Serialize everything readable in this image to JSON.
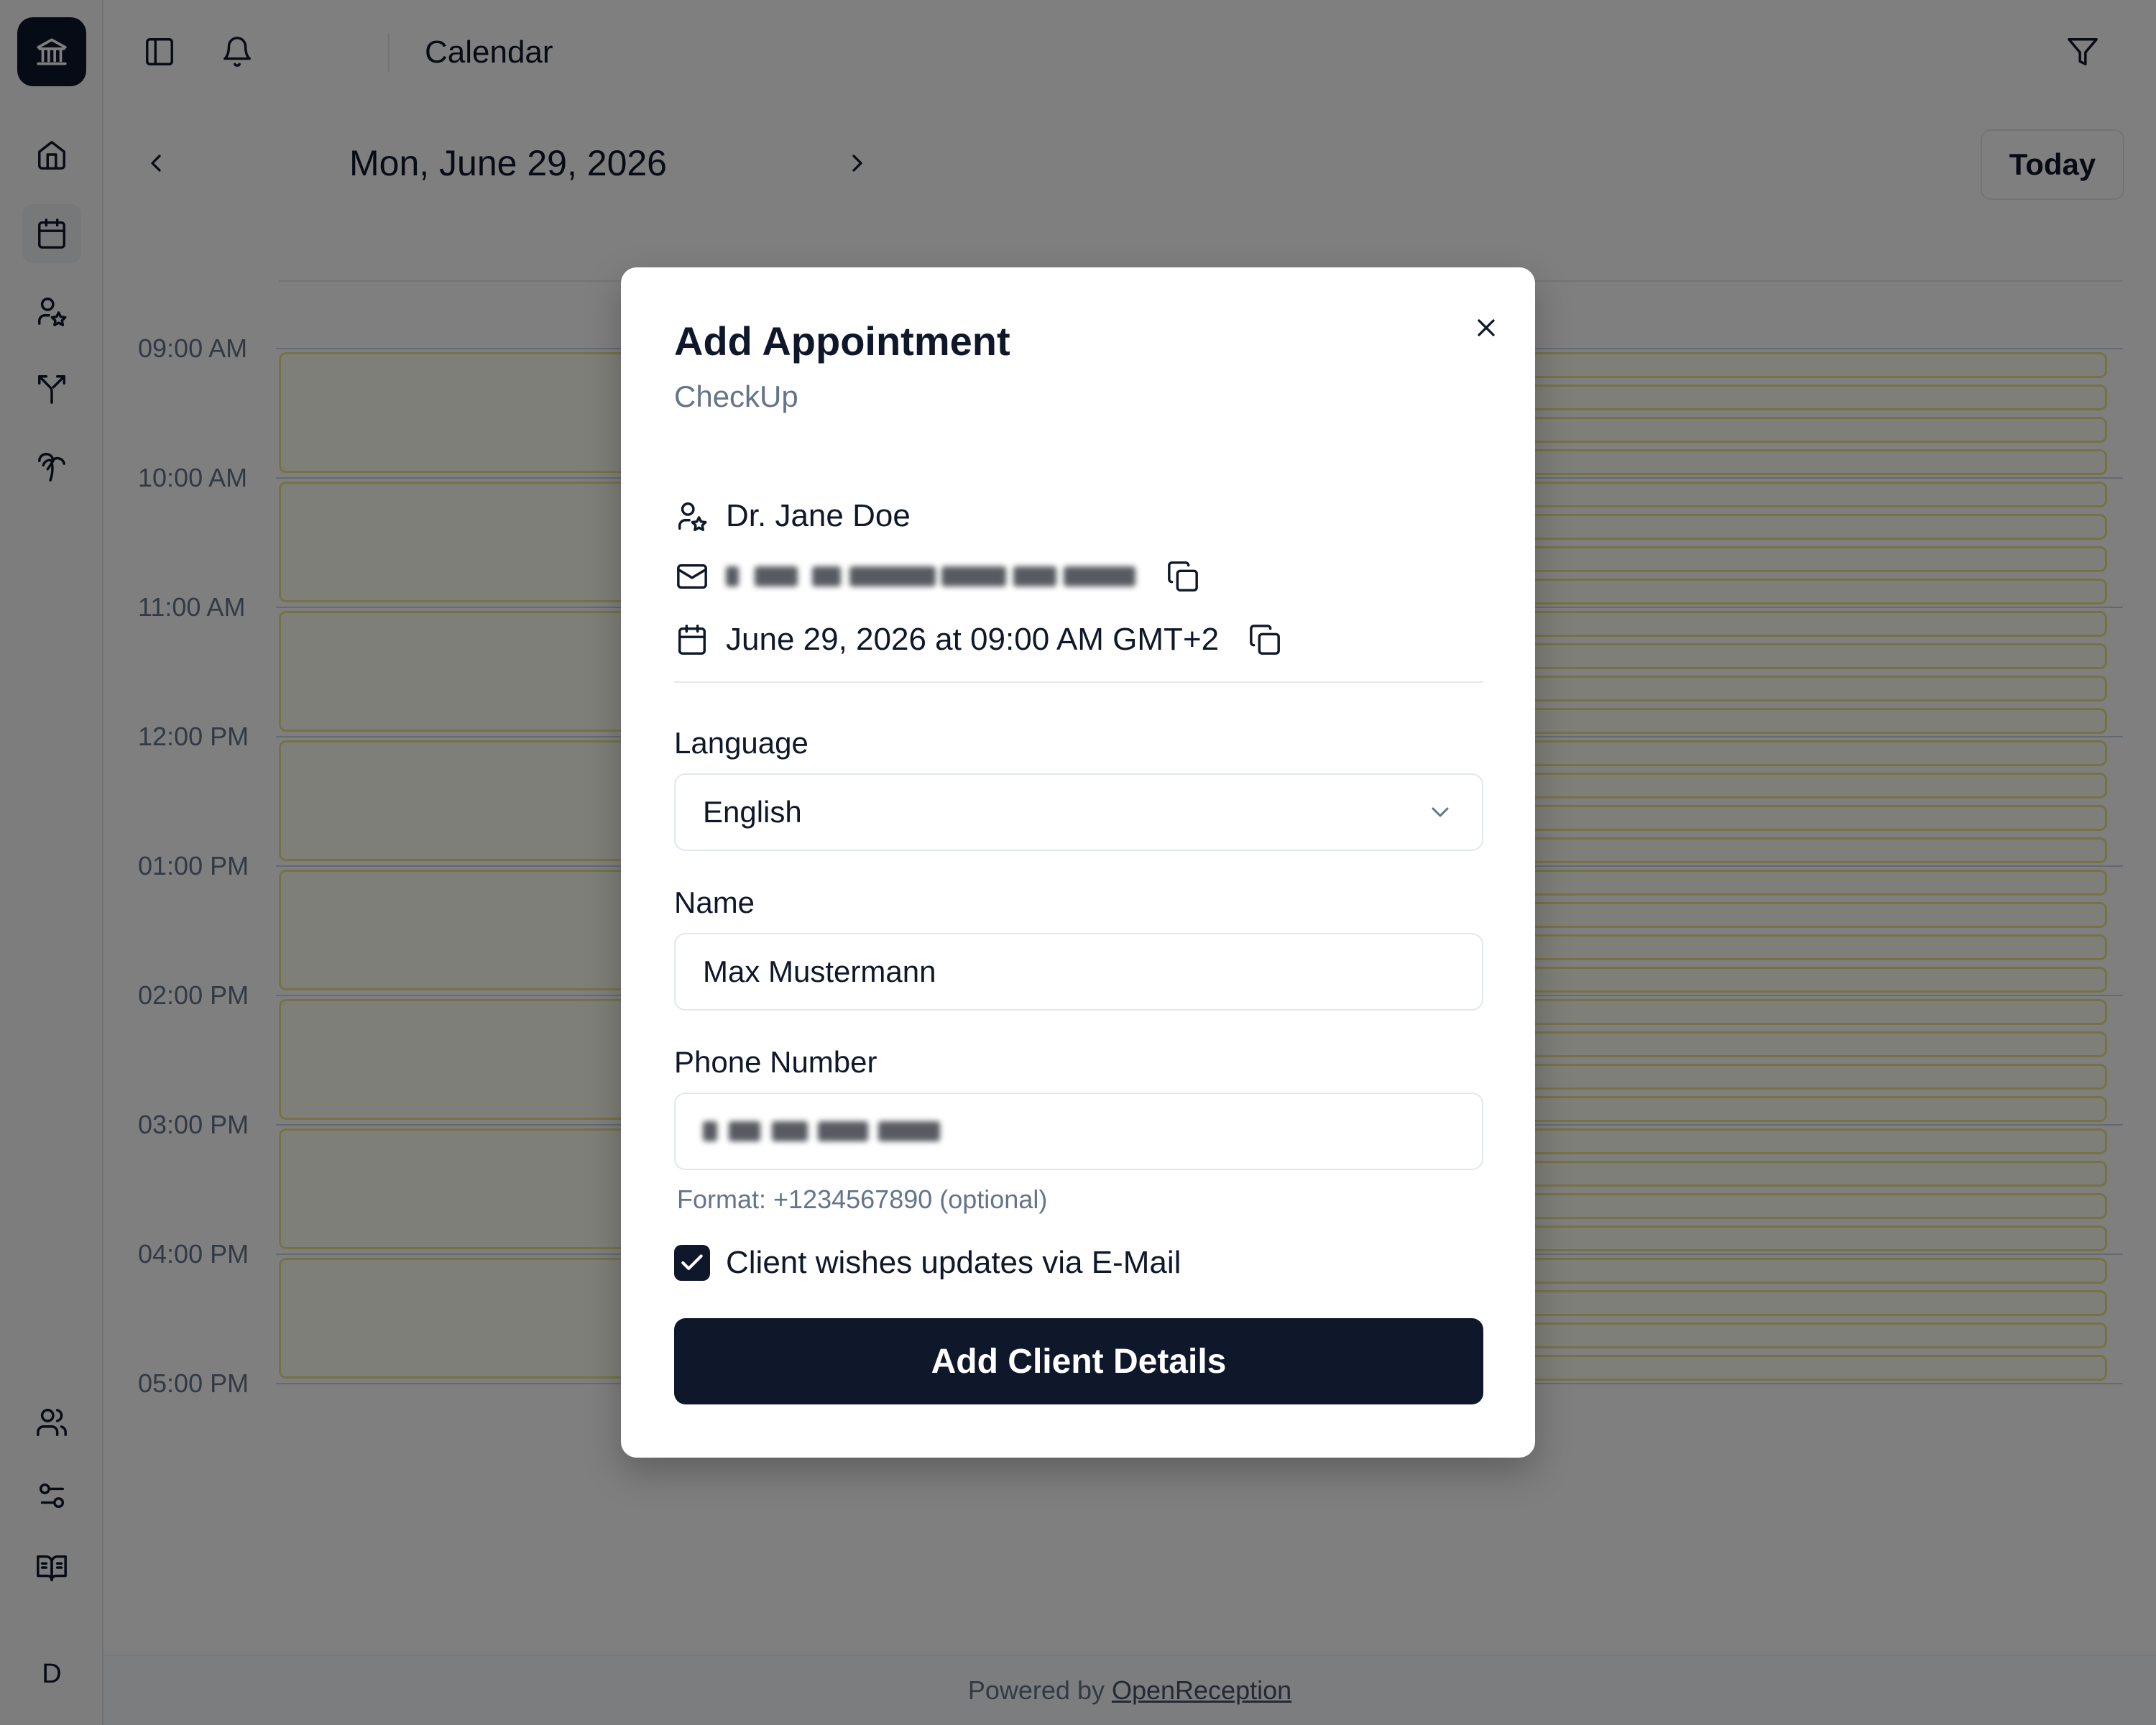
{
  "header": {
    "title": "Calendar"
  },
  "date_nav": {
    "date": "Mon, June 29, 2026",
    "today_label": "Today"
  },
  "calendar": {
    "hours": [
      "09:00 AM",
      "10:00 AM",
      "11:00 AM",
      "12:00 PM",
      "01:00 PM",
      "02:00 PM",
      "03:00 PM",
      "04:00 PM",
      "05:00 PM"
    ]
  },
  "sidebar": {
    "icons": [
      "bank-icon",
      "home-icon",
      "calendar-icon",
      "user-star-icon",
      "split-icon",
      "palm-tree-icon",
      "users-icon",
      "sliders-icon",
      "book-open-icon"
    ],
    "avatar_initial": "D"
  },
  "footer": {
    "prefix": "Powered by",
    "link": "OpenReception"
  },
  "dialog": {
    "title": "Add Appointment",
    "subtitle": "CheckUp",
    "doctor": "Dr. Jane Doe",
    "datetime": "June 29, 2026 at 09:00 AM GMT+2",
    "language": {
      "label": "Language",
      "value": "English"
    },
    "name": {
      "label": "Name",
      "value": "Max Mustermann"
    },
    "phone": {
      "label": "Phone Number",
      "hint": "Format: +1234567890 (optional)"
    },
    "email_updates": {
      "label": "Client wishes updates via E-Mail",
      "checked": true
    },
    "submit_label": "Add Client Details"
  },
  "colors": {
    "primary": "#0f172a",
    "slot_border": "#ebe78d",
    "muted": "#64748b"
  }
}
